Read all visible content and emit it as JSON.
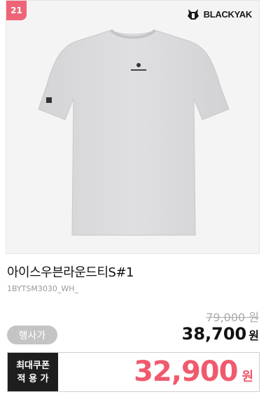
{
  "product": {
    "rank": "21",
    "brand": "BLACKYAK",
    "name": "아이스우븐라운드티S#1",
    "code": "1BYTSM3030_WH_"
  },
  "pricing": {
    "original_price": "79,000 원",
    "event_label": "행사가",
    "event_price": "38,700",
    "event_unit": "원",
    "coupon_label_line1": "최대쿠폰",
    "coupon_label_line2": "적 용 가",
    "coupon_price": "32,900",
    "coupon_unit": "원"
  },
  "colors": {
    "rank_badge": "#f06478",
    "coupon_price": "#f05a6e",
    "coupon_label_bg": "#1e1e1e",
    "event_badge_bg": "#c4c4c4"
  }
}
